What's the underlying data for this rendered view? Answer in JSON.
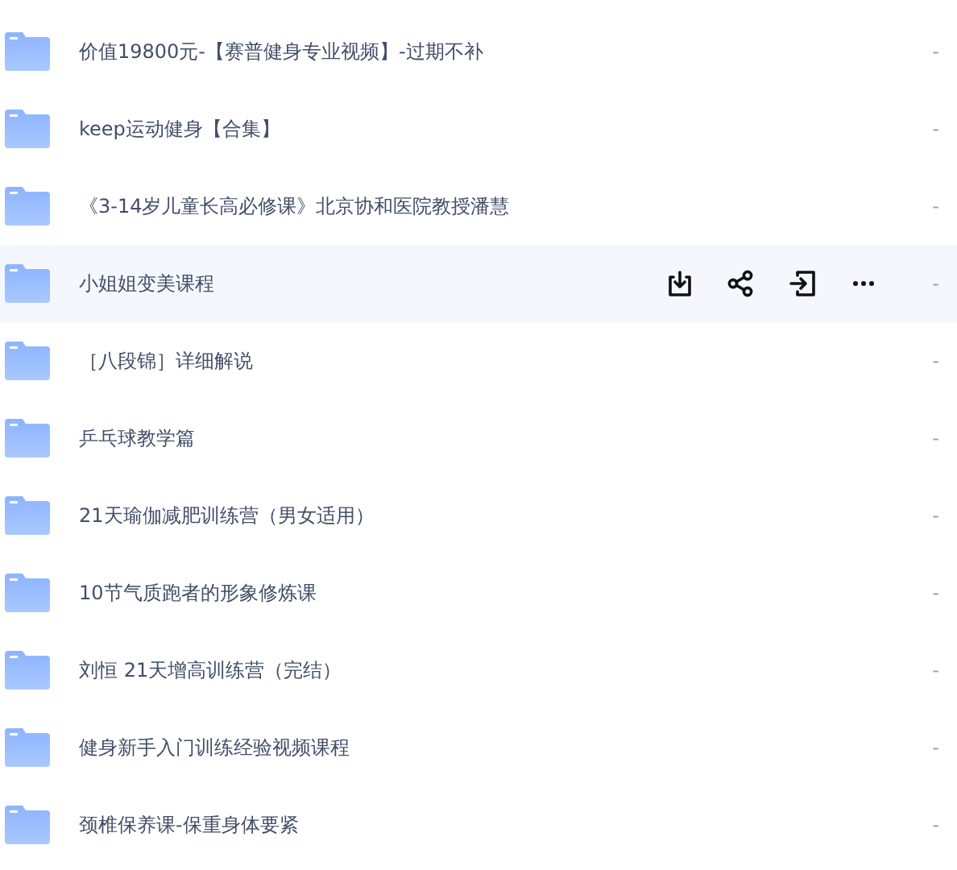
{
  "files": [
    {
      "name": "价值19800元-【赛普健身专业视频】-过期不补",
      "size": "-",
      "hovered": false
    },
    {
      "name": "keep运动健身【合集】",
      "size": "-",
      "hovered": false
    },
    {
      "name": "《3-14岁儿童长高必修课》北京协和医院教授潘慧",
      "size": "-",
      "hovered": false
    },
    {
      "name": "小姐姐变美课程",
      "size": "-",
      "hovered": true
    },
    {
      "name": "［八段锦］详细解说",
      "size": "-",
      "hovered": false
    },
    {
      "name": "乒乓球教学篇",
      "size": "-",
      "hovered": false
    },
    {
      "name": "21天瑜伽减肥训练营（男女适用）",
      "size": "-",
      "hovered": false
    },
    {
      "name": "10节气质跑者的形象修炼课",
      "size": "-",
      "hovered": false
    },
    {
      "name": "刘恒 21天增高训练营（完结）",
      "size": "-",
      "hovered": false
    },
    {
      "name": "健身新手入门训练经验视频课程",
      "size": "-",
      "hovered": false
    },
    {
      "name": "颈椎保养课-保重身体要紧",
      "size": "-",
      "hovered": false
    }
  ]
}
